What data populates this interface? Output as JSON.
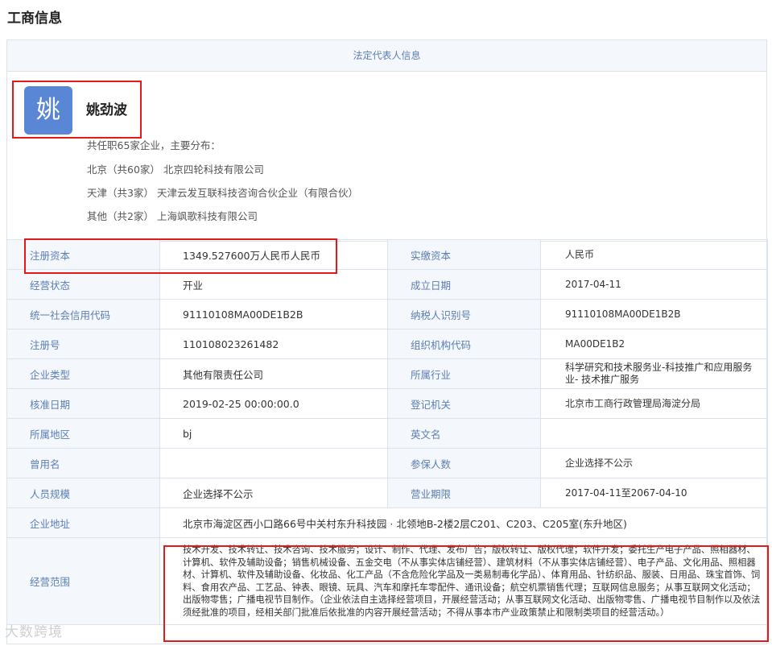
{
  "page_title": "工商信息",
  "legal_section": {
    "header": "法定代表人信息",
    "avatar_char": "姚",
    "name": "姚劲波",
    "summary": "共任职65家企业，主要分布：",
    "distribution": [
      {
        "region": "北京（共60家）",
        "company": "北京四轮科技有限公司"
      },
      {
        "region": "天津（共3家）",
        "company": "天津云发互联科技咨询合伙企业（有限合伙）"
      },
      {
        "region": "其他（共2家）",
        "company": "上海飒歌科技有限公司"
      }
    ]
  },
  "fields": {
    "reg_capital_label": "注册资本",
    "reg_capital": "1349.527600万人民币人民币",
    "paid_capital_label": "实缴资本",
    "paid_capital": "人民币",
    "status_label": "经营状态",
    "status": "开业",
    "founded_label": "成立日期",
    "founded": "2017-04-11",
    "credit_code_label": "统一社会信用代码",
    "credit_code": "91110108MA00DE1B2B",
    "taxpayer_label": "纳税人识别号",
    "taxpayer": "91110108MA00DE1B2B",
    "reg_no_label": "注册号",
    "reg_no": "110108023261482",
    "org_code_label": "组织机构代码",
    "org_code": "MA00DE1B2",
    "company_type_label": "企业类型",
    "company_type": "其他有限责任公司",
    "industry_label": "所属行业",
    "industry": "科学研究和技术服务业-科技推广和应用服务业- 技术推广服务",
    "approval_date_label": "核准日期",
    "approval_date": "2019-02-25 00:00:00.0",
    "authority_label": "登记机关",
    "authority": "北京市工商行政管理局海淀分局",
    "region_label": "所属地区",
    "region": "bj",
    "english_name_label": "英文名",
    "english_name": "",
    "former_name_label": "曾用名",
    "former_name": "",
    "insured_label": "参保人数",
    "insured": "企业选择不公示",
    "staff_size_label": "人员规模",
    "staff_size": "企业选择不公示",
    "term_label": "营业期限",
    "term": "2017-04-11至2067-04-10",
    "address_label": "企业地址",
    "address": "北京市海淀区西小口路66号中关村东升科技园 · 北领地B-2楼2层C201、C203、C205室(东升地区)",
    "scope_label": "经营范围",
    "scope": "技术开发、技术转让、技术咨询、技术服务；设计、制作、代理、发布广告；版权转让、版权代理；软件开发；委托生产电子产品、照相器材、计算机、软件及辅助设备；销售机械设备、五金交电（不从事实体店铺经营）、建筑材料（不从事实体店铺经营）、电子产品、文化用品、照相器材、计算机、软件及辅助设备、化妆品、化工产品（不含危险化学品及一类易制毒化学品）、体育用品、针纺织品、服装、日用品、珠宝首饰、饲料、食用农产品、工艺品、钟表、眼镜、玩具、汽车和摩托车零配件、通讯设备；航空机票销售代理；互联网信息服务；从事互联网文化活动；出版物零售；广播电视节目制作。（企业依法自主选择经营项目，开展经营活动；从事互联网文化活动、出版物零售、广播电视节目制作以及依法须经批准的项目，经相关部门批准后依批准的内容开展经营活动；不得从事本市产业政策禁止和限制类项目的经营活动。）"
  },
  "watermark": "大数跨境",
  "colors": {
    "accent": "#5a7fb3",
    "label_bg": "#f4f7fb",
    "highlight": "#e31a1a",
    "avatar_bg": "#5a86d6"
  }
}
